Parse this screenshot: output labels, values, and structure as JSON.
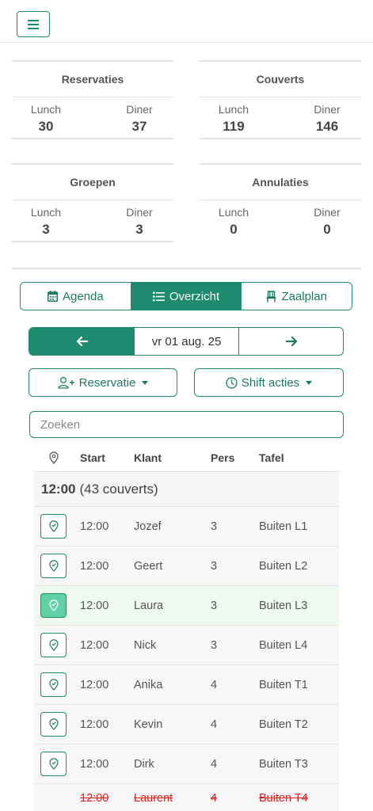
{
  "header": {
    "menu_icon": "hamburger-icon"
  },
  "stats": {
    "reservaties": {
      "title": "Reservaties",
      "lunch_label": "Lunch",
      "lunch": "30",
      "diner_label": "Diner",
      "diner": "37"
    },
    "couverts": {
      "title": "Couverts",
      "lunch_label": "Lunch",
      "lunch": "119",
      "diner_label": "Diner",
      "diner": "146"
    },
    "groepen": {
      "title": "Groepen",
      "lunch_label": "Lunch",
      "lunch": "3",
      "diner_label": "Diner",
      "diner": "3"
    },
    "annulaties": {
      "title": "Annulaties",
      "lunch_label": "Lunch",
      "lunch": "0",
      "diner_label": "Diner",
      "diner": "0"
    }
  },
  "tabs": [
    {
      "label": "Agenda",
      "icon": "calendar-icon",
      "active": false
    },
    {
      "label": "Overzicht",
      "icon": "list-icon",
      "active": true
    },
    {
      "label": "Zaalplan",
      "icon": "chair-icon",
      "active": false
    }
  ],
  "date_nav": {
    "date": "vr 01 aug. 25"
  },
  "actions": {
    "reservatie_label": "Reservatie",
    "shift_label": "Shift acties"
  },
  "search": {
    "placeholder": "Zoeken",
    "value": ""
  },
  "table": {
    "headers": {
      "start": "Start",
      "klant": "Klant",
      "pers": "Pers",
      "tafel": "Tafel"
    },
    "group": {
      "time": "12:00",
      "couverts": "(43 couverts)"
    },
    "rows": [
      {
        "start": "12:00",
        "klant": "Jozef",
        "pers": "3",
        "tafel": "Buiten L1",
        "status": "normal"
      },
      {
        "start": "12:00",
        "klant": "Geert",
        "pers": "3",
        "tafel": "Buiten L2",
        "status": "normal"
      },
      {
        "start": "12:00",
        "klant": "Laura",
        "pers": "3",
        "tafel": "Buiten L3",
        "status": "arrived"
      },
      {
        "start": "12:00",
        "klant": "Nick",
        "pers": "3",
        "tafel": "Buiten L4",
        "status": "normal"
      },
      {
        "start": "12:00",
        "klant": "Anika",
        "pers": "4",
        "tafel": "Buiten T1",
        "status": "normal"
      },
      {
        "start": "12:00",
        "klant": "Kevin",
        "pers": "4",
        "tafel": "Buiten T2",
        "status": "normal"
      },
      {
        "start": "12:00",
        "klant": "Dirk",
        "pers": "4",
        "tafel": "Buiten T3",
        "status": "normal"
      },
      {
        "start": "12:00",
        "klant": "Laurent",
        "pers": "4",
        "tafel": "Buiten T4",
        "status": "cancelled"
      }
    ]
  },
  "colors": {
    "accent": "#1e8a6e",
    "arrived": "#5fd0a8",
    "cancelled": "#e01b1b"
  }
}
